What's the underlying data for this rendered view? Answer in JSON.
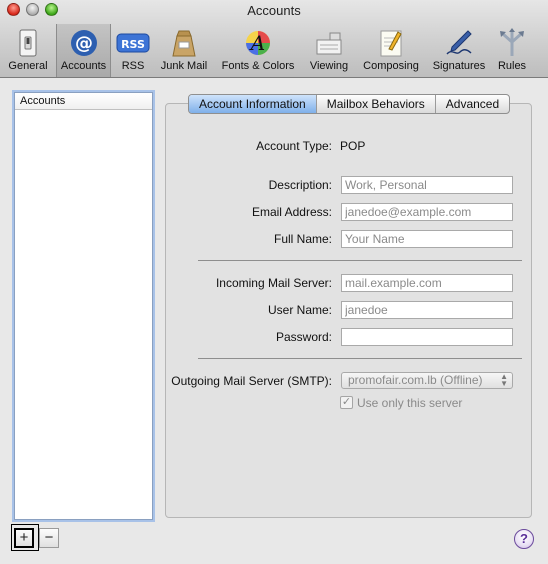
{
  "window": {
    "title": "Accounts"
  },
  "toolbar": {
    "items": [
      {
        "label": "General",
        "icon": "light-switch-icon"
      },
      {
        "label": "Accounts",
        "icon": "at-sign-icon",
        "selected": true
      },
      {
        "label": "RSS",
        "icon": "rss-icon"
      },
      {
        "label": "Junk Mail",
        "icon": "junk-mail-bag-icon"
      },
      {
        "label": "Fonts & Colors",
        "icon": "fonts-colors-icon"
      },
      {
        "label": "Viewing",
        "icon": "viewing-icon"
      },
      {
        "label": "Composing",
        "icon": "composing-pencil-icon"
      },
      {
        "label": "Signatures",
        "icon": "signature-pen-icon"
      },
      {
        "label": "Rules",
        "icon": "rules-arrows-icon"
      }
    ]
  },
  "sidebar": {
    "header": "Accounts",
    "add_label": "+",
    "remove_label": "−"
  },
  "tabs": [
    {
      "label": "Account Information",
      "active": true
    },
    {
      "label": "Mailbox Behaviors"
    },
    {
      "label": "Advanced"
    }
  ],
  "form": {
    "account_type_label": "Account Type:",
    "account_type_value": "POP",
    "description_label": "Description:",
    "description_placeholder": "Work, Personal",
    "email_label": "Email Address:",
    "email_placeholder": "janedoe@example.com",
    "fullname_label": "Full Name:",
    "fullname_placeholder": "Your Name",
    "incoming_label": "Incoming Mail Server:",
    "incoming_placeholder": "mail.example.com",
    "username_label": "User Name:",
    "username_placeholder": "janedoe",
    "password_label": "Password:",
    "password_value": "",
    "smtp_label": "Outgoing Mail Server (SMTP):",
    "smtp_value": "promofair.com.lb (Offline)",
    "use_only_label": "Use only this server",
    "use_only_checked": true
  },
  "help": {
    "label": "?"
  },
  "colors": {
    "tab_active": "#7fb0ea",
    "list_focus": "#a8c2e8",
    "help_icon": "#5a2f99"
  }
}
